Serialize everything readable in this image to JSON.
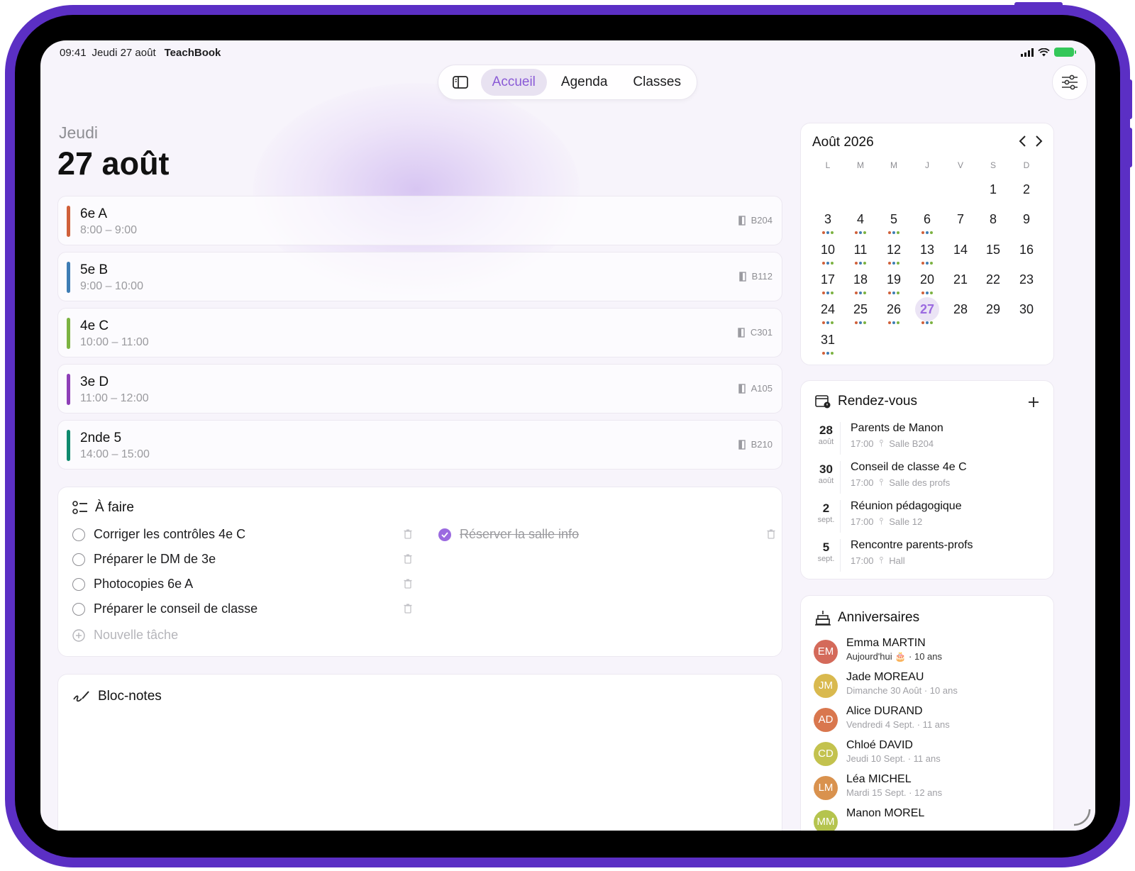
{
  "status": {
    "time": "09:41",
    "date": "Jeudi 27 août",
    "app_name": "TeachBook"
  },
  "nav": {
    "tabs": [
      {
        "label": "Accueil",
        "active": true
      },
      {
        "label": "Agenda",
        "active": false
      },
      {
        "label": "Classes",
        "active": false
      }
    ],
    "sidebar_icon": "sidebar-toggle-icon",
    "settings_icon": "sliders-icon"
  },
  "heading": {
    "day": "Jeudi",
    "date": "27 août"
  },
  "lessons": [
    {
      "name": "6e A",
      "time": "8:00 – 9:00",
      "room": "B204",
      "color": "#d0603a"
    },
    {
      "name": "5e B",
      "time": "9:00 – 10:00",
      "room": "B112",
      "color": "#3e7db4"
    },
    {
      "name": "4e C",
      "time": "10:00 – 11:00",
      "room": "C301",
      "color": "#7cb342"
    },
    {
      "name": "3e D",
      "time": "11:00 – 12:00",
      "room": "A105",
      "color": "#8e3fb7"
    },
    {
      "name": "2nde 5",
      "time": "14:00 – 15:00",
      "room": "B210",
      "color": "#0f8a6e"
    }
  ],
  "todo": {
    "title": "À faire",
    "tasks": [
      {
        "label": "Corriger les contrôles 4e C",
        "done": false
      },
      {
        "label": "Préparer le DM de 3e",
        "done": false
      },
      {
        "label": "Photocopies 6e A",
        "done": false
      },
      {
        "label": "Préparer le conseil de classe",
        "done": false
      },
      {
        "label": "Réserver la salle info",
        "done": true
      }
    ],
    "new_task_placeholder": "Nouvelle tâche"
  },
  "notes": {
    "title": "Bloc-notes"
  },
  "calendar": {
    "month_label": "Août 2026",
    "weekdays": [
      "L",
      "M",
      "M",
      "J",
      "V",
      "S",
      "D"
    ],
    "first_weekday_index": 5,
    "days_in_month": 31,
    "today": 27,
    "days_with_events": [
      3,
      4,
      5,
      6,
      10,
      11,
      12,
      13,
      17,
      18,
      19,
      20,
      24,
      25,
      26,
      27,
      31
    ],
    "dot_colors": [
      "#d0603a",
      "#3e7db4",
      "#7cb342"
    ]
  },
  "appointments": {
    "title": "Rendez-vous",
    "add_icon": "plus-icon",
    "items": [
      {
        "day": "28",
        "month": "août",
        "title": "Parents de Manon",
        "time": "17:00",
        "place": "Salle B204"
      },
      {
        "day": "30",
        "month": "août",
        "title": "Conseil de classe 4e C",
        "time": "17:00",
        "place": "Salle des profs"
      },
      {
        "day": "2",
        "month": "sept.",
        "title": "Réunion pédagogique",
        "time": "17:00",
        "place": "Salle 12"
      },
      {
        "day": "5",
        "month": "sept.",
        "title": "Rencontre parents-profs",
        "time": "17:00",
        "place": "Hall"
      }
    ]
  },
  "birthdays": {
    "title": "Anniversaires",
    "people": [
      {
        "initials": "EM",
        "name": "Emma MARTIN",
        "detail": "Aujourd'hui 🎂 · 10 ans",
        "color": "#d46a5a",
        "today": true
      },
      {
        "initials": "JM",
        "name": "Jade MOREAU",
        "detail": "Dimanche 30 Août · 10 ans",
        "color": "#d9b94e",
        "today": false
      },
      {
        "initials": "AD",
        "name": "Alice DURAND",
        "detail": "Vendredi 4 Sept. · 11 ans",
        "color": "#d9774e",
        "today": false
      },
      {
        "initials": "CD",
        "name": "Chloé DAVID",
        "detail": "Jeudi 10 Sept. · 11 ans",
        "color": "#c3c24e",
        "today": false
      },
      {
        "initials": "LM",
        "name": "Léa MICHEL",
        "detail": "Mardi 15 Sept. · 12 ans",
        "color": "#d9924e",
        "today": false
      },
      {
        "initials": "MM",
        "name": "Manon MOREL",
        "detail": "",
        "color": "#b5c44e",
        "today": false
      }
    ]
  }
}
